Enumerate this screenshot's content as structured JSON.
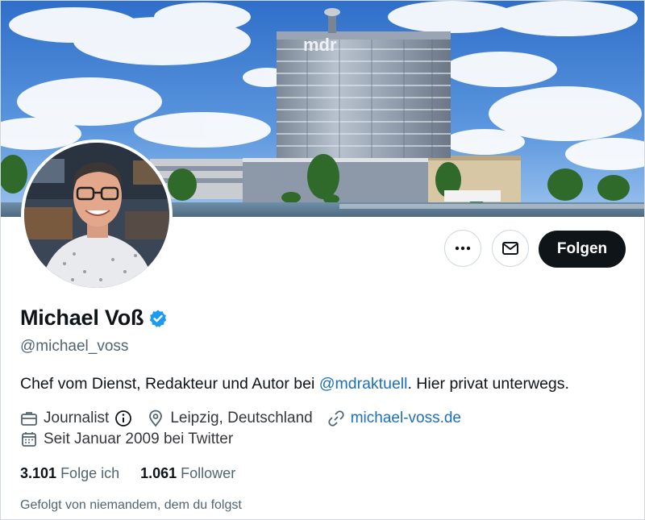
{
  "profile": {
    "name": "Michael Voß",
    "handle": "@michael_voss",
    "bio_prefix": "Chef vom Dienst, Redakteur und Autor bei ",
    "bio_link": "@mdraktuell",
    "bio_suffix": ". Hier privat unterwegs.",
    "category": "Journalist",
    "location": "Leipzig, Deutschland",
    "website": "michael-voss.de",
    "joined": "Seit Januar 2009 bei Twitter",
    "following_count": "3.101",
    "following_label": "Folge ich",
    "followers_count": "1.061",
    "followers_label": "Follower",
    "followed_by": "Gefolgt von niemandem, dem du folgst"
  },
  "actions": {
    "follow_label": "Folgen"
  },
  "banner": {
    "building_text": "mdr"
  },
  "colors": {
    "link": "#1d6fb8",
    "verified": "#1d9bf0",
    "follow_bg": "#0f1419"
  },
  "icons": [
    "more-icon",
    "mail-icon",
    "verified-icon",
    "briefcase-icon",
    "info-icon",
    "location-icon",
    "link-icon",
    "calendar-icon"
  ]
}
